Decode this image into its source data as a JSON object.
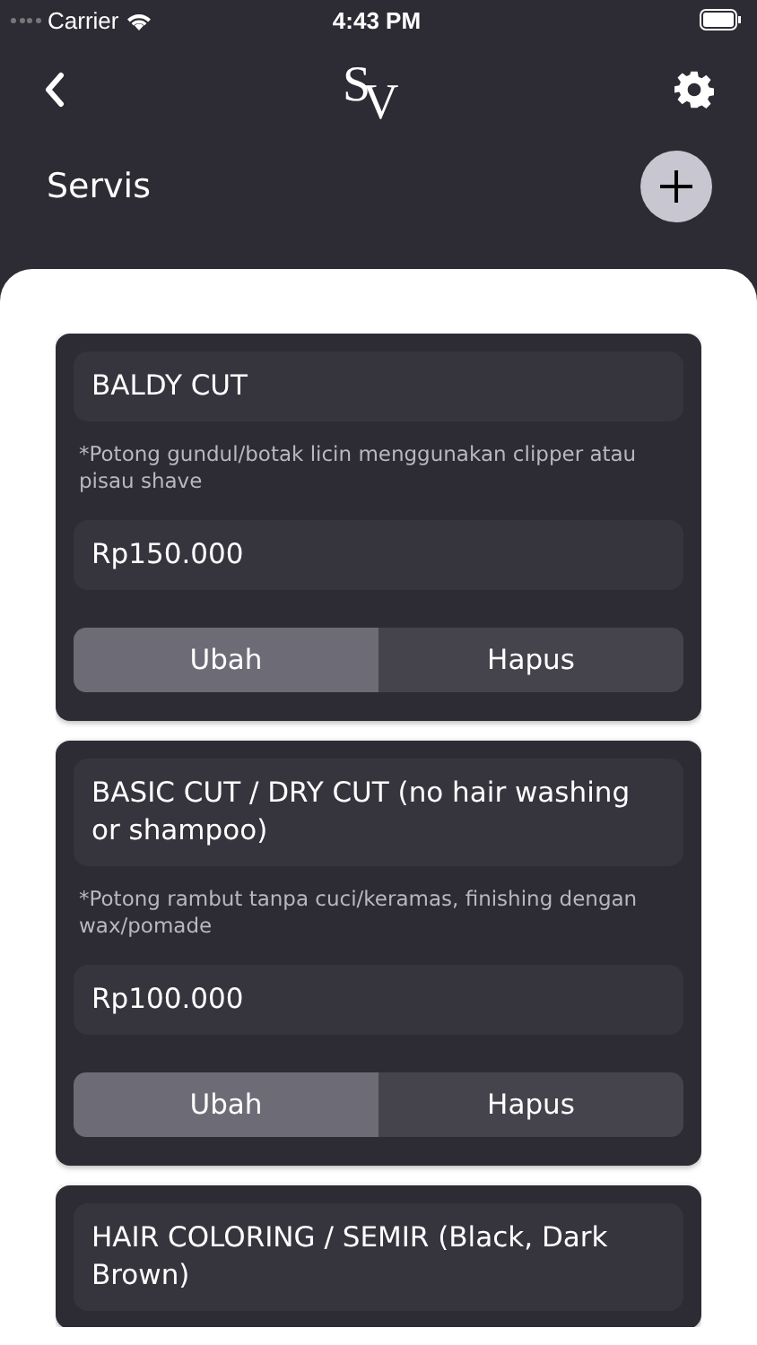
{
  "status_bar": {
    "carrier": "Carrier",
    "time": "4:43 PM"
  },
  "nav": {
    "logo_letters": [
      "S",
      "V"
    ]
  },
  "title": "Servis",
  "services": [
    {
      "name": "BALDY CUT",
      "description": "*Potong gundul/botak licin menggunakan clipper atau pisau shave",
      "price": "Rp150.000",
      "buttons": [
        "Ubah",
        "Hapus"
      ]
    },
    {
      "name": "BASIC CUT / DRY CUT (no hair washing or shampoo)",
      "description": "*Potong rambut tanpa cuci/keramas, finishing dengan wax/pomade",
      "price": "Rp100.000",
      "buttons": [
        "Ubah",
        "Hapus"
      ]
    },
    {
      "name": "HAIR COLORING / SEMIR (Black, Dark Brown)"
    }
  ]
}
